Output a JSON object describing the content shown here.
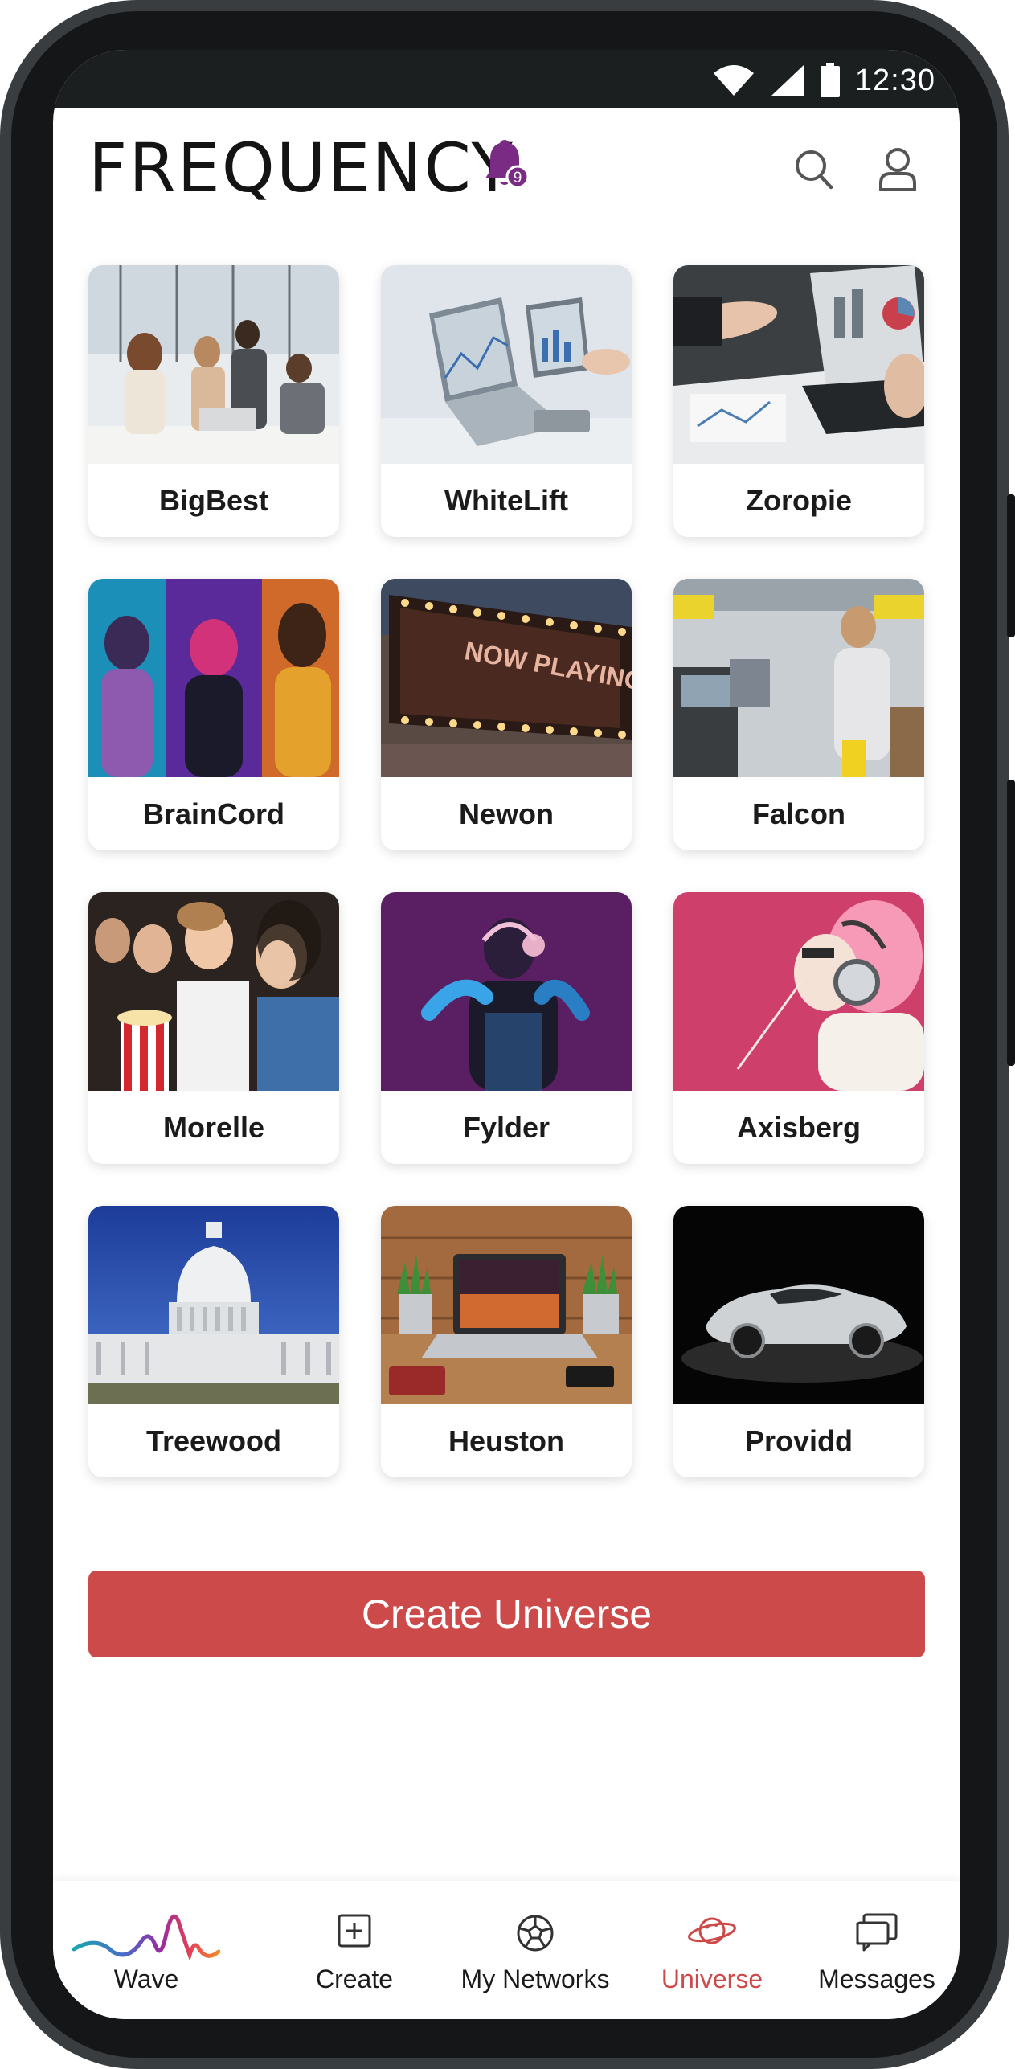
{
  "status_bar": {
    "time": "12:30",
    "icons": [
      "wifi-icon",
      "cell-signal-icon",
      "battery-icon"
    ]
  },
  "header": {
    "title": "FREQUENCY",
    "notification_count": "9",
    "icons": [
      "bell-icon",
      "search-icon",
      "profile-icon"
    ]
  },
  "universes": [
    {
      "name": "BigBest",
      "image": "office-team-photo"
    },
    {
      "name": "WhiteLift",
      "image": "laptop-charts-photo"
    },
    {
      "name": "Zoropie",
      "image": "business-analytics-photo"
    },
    {
      "name": "BrainCord",
      "image": "neon-portraits-photo"
    },
    {
      "name": "Newon",
      "image": "now-playing-marquee-photo"
    },
    {
      "name": "Falcon",
      "image": "self-checkout-store-photo"
    },
    {
      "name": "Morelle",
      "image": "cinema-audience-photo"
    },
    {
      "name": "Fylder",
      "image": "dj-headphones-photo"
    },
    {
      "name": "Axisberg",
      "image": "pink-hair-headphones-photo"
    },
    {
      "name": "Treewood",
      "image": "capitol-building-photo"
    },
    {
      "name": "Heuston",
      "image": "laptop-desk-plants-photo"
    },
    {
      "name": "Providd",
      "image": "sports-car-photo"
    }
  ],
  "marquee_text": "NOW PLAYING",
  "create_button": {
    "label": "Create Universe"
  },
  "bottom_nav": [
    {
      "label": "Wave",
      "icon": "wave-icon",
      "active": false
    },
    {
      "label": "Create",
      "icon": "plus-square-icon",
      "active": false
    },
    {
      "label": "My Networks",
      "icon": "soccer-ball-icon",
      "active": false
    },
    {
      "label": "Universe",
      "icon": "planet-icon",
      "active": true
    },
    {
      "label": "Messages",
      "icon": "messages-icon",
      "active": false
    }
  ],
  "colors": {
    "accent": "#cc4a4a",
    "bell": "#7a2b84",
    "text": "#1b1b1b"
  }
}
